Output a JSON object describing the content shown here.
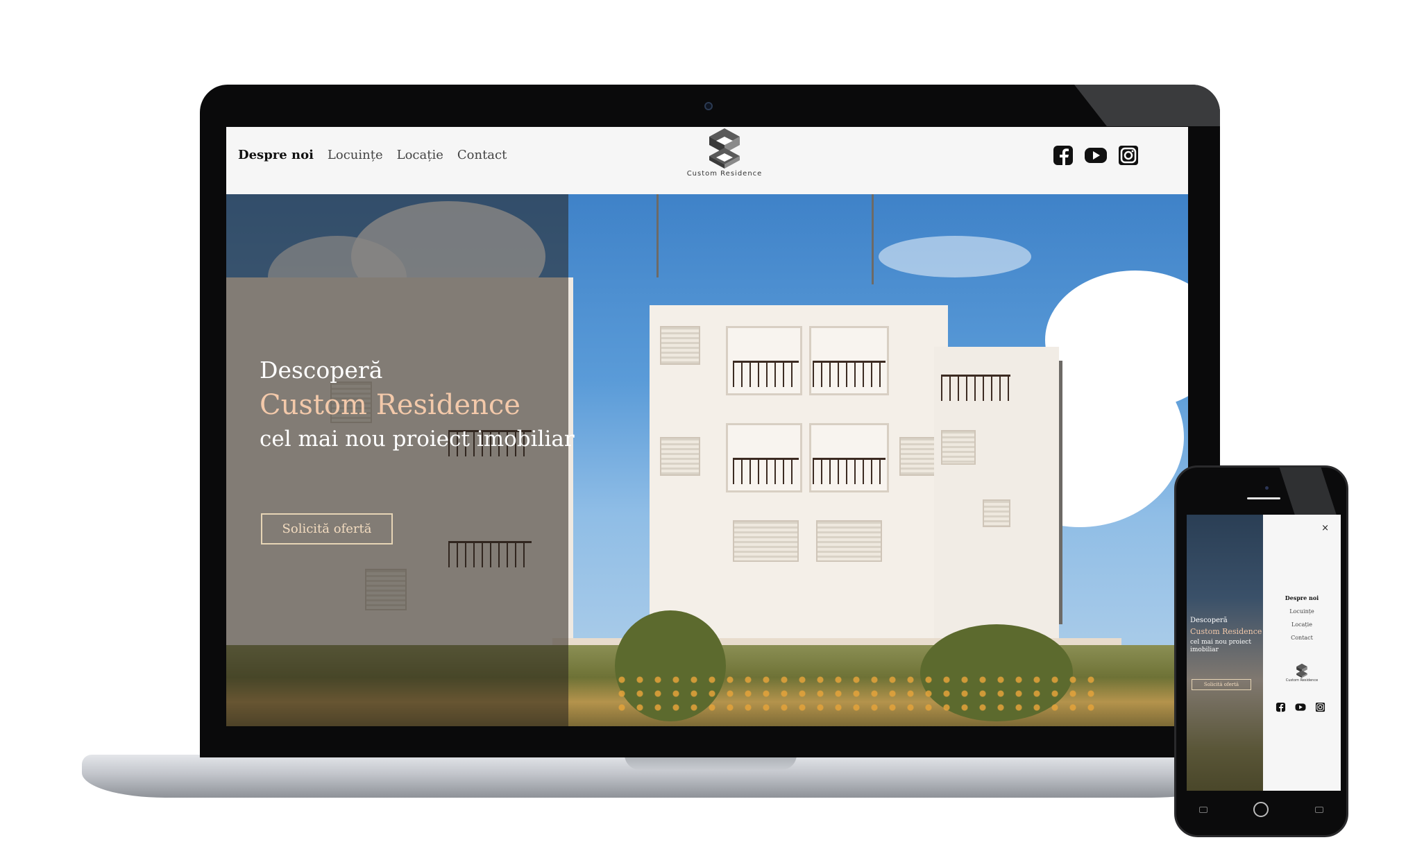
{
  "desktop": {
    "nav": {
      "items": [
        {
          "label": "Despre noi",
          "active": true
        },
        {
          "label": "Locuințe",
          "active": false
        },
        {
          "label": "Locație",
          "active": false
        },
        {
          "label": "Contact",
          "active": false
        }
      ]
    },
    "logo": {
      "text": "Custom Residence"
    },
    "social": [
      "facebook-icon",
      "youtube-icon",
      "instagram-icon"
    ],
    "hero": {
      "line1": "Descoperă",
      "line2": "Custom Residence",
      "line3": "cel mai nou proiect imobiliar",
      "button": "Solicită ofertă"
    }
  },
  "mobile": {
    "close": "×",
    "nav": {
      "items": [
        {
          "label": "Despre noi",
          "active": true
        },
        {
          "label": "Locuințe",
          "active": false
        },
        {
          "label": "Locație",
          "active": false
        },
        {
          "label": "Contact",
          "active": false
        }
      ]
    },
    "logo": {
      "text": "Custom Residence"
    },
    "social": [
      "facebook-icon",
      "youtube-icon",
      "instagram-icon"
    ],
    "hero": {
      "line1": "Descoperă",
      "line2": "Custom Residence",
      "line3": "cel mai nou proiect imobiliar",
      "button": "Solicită ofertă"
    }
  },
  "colors": {
    "accent": "#f3c9aa",
    "button_border": "#e7d5b5",
    "header_bg": "#f6f6f6"
  }
}
